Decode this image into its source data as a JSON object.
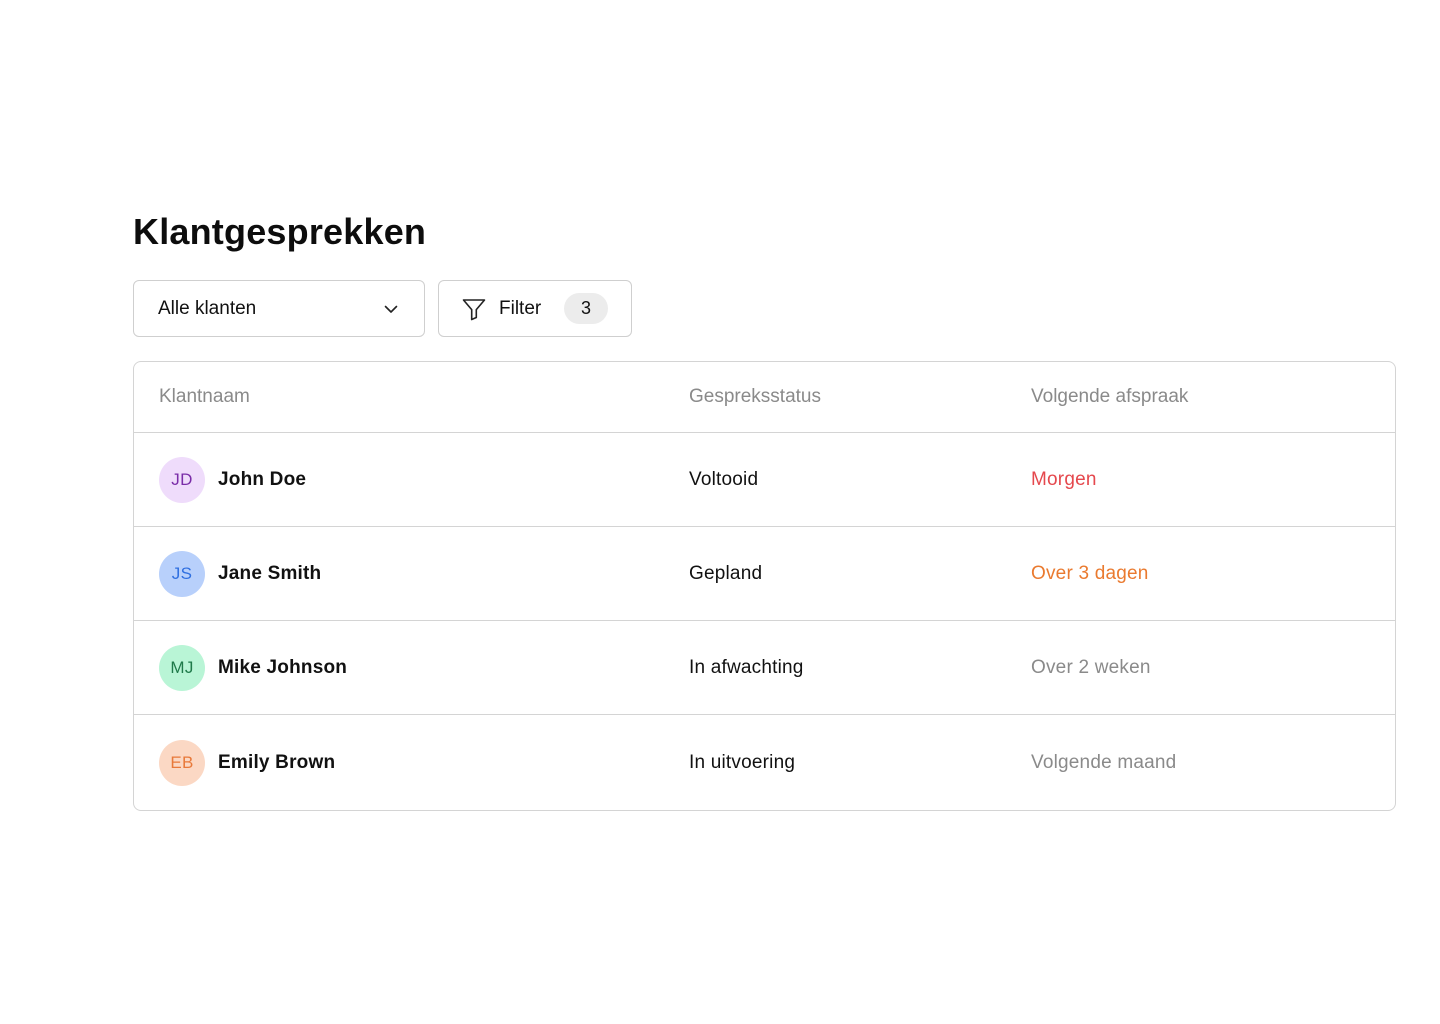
{
  "page": {
    "title": "Klantgesprekken"
  },
  "toolbar": {
    "client_select": {
      "value": "Alle klanten",
      "icon": "chevron-down-icon"
    },
    "filter": {
      "label": "Filter",
      "count": "3",
      "icon": "funnel-icon"
    }
  },
  "table": {
    "columns": {
      "name": "Klantnaam",
      "status": "Gespreksstatus",
      "next": "Volgende afspraak"
    },
    "rows": [
      {
        "initials": "JD",
        "name": "John Doe",
        "status": "Voltooid",
        "next": "Morgen",
        "avatar_bg": "#efdcfb",
        "avatar_fg": "#7a2da8",
        "next_color": "#e5484d"
      },
      {
        "initials": "JS",
        "name": "Jane Smith",
        "status": "Gepland",
        "next": "Over 3 dagen",
        "avatar_bg": "#b8d0fb",
        "avatar_fg": "#2f6fe0",
        "next_color": "#ea7a2f"
      },
      {
        "initials": "MJ",
        "name": "Mike Johnson",
        "status": "In afwachting",
        "next": "Over 2 weken",
        "avatar_bg": "#b9f5d6",
        "avatar_fg": "#1f7a4a",
        "next_color": "#8a8a8a"
      },
      {
        "initials": "EB",
        "name": "Emily Brown",
        "status": "In uitvoering",
        "next": "Volgende maand",
        "avatar_bg": "#fbd8c4",
        "avatar_fg": "#e8793a",
        "next_color": "#8a8a8a"
      }
    ]
  }
}
